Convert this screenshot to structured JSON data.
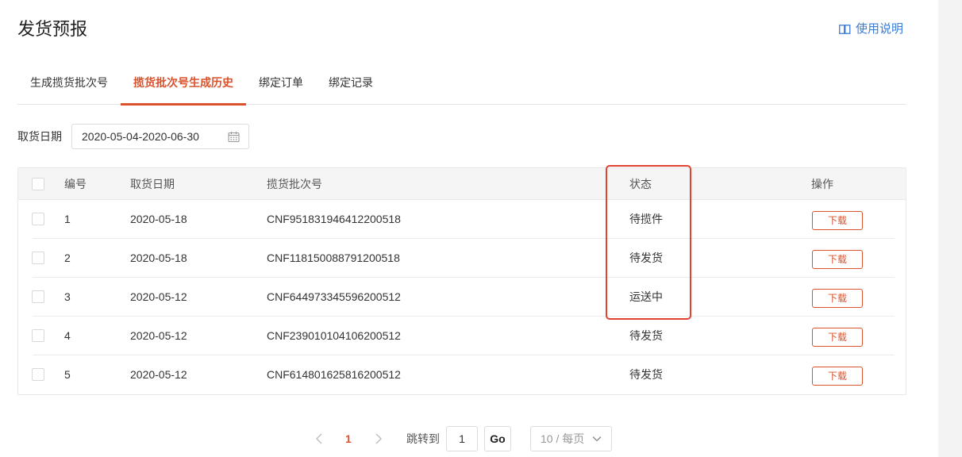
{
  "page": {
    "title": "发货预报"
  },
  "help": {
    "label": "使用说明"
  },
  "tabs": [
    {
      "label": "生成揽货批次号"
    },
    {
      "label": "揽货批次号生成历史"
    },
    {
      "label": "绑定订单"
    },
    {
      "label": "绑定记录"
    }
  ],
  "active_tab": 1,
  "filter": {
    "label": "取货日期",
    "value": "2020-05-04-2020-06-30"
  },
  "table": {
    "headers": {
      "id": "编号",
      "date": "取货日期",
      "batch": "揽货批次号",
      "status": "状态",
      "op": "操作"
    },
    "rows": [
      {
        "id": "1",
        "date": "2020-05-18",
        "batch": "CNF951831946412200518",
        "status": "待揽件",
        "action": "下载"
      },
      {
        "id": "2",
        "date": "2020-05-18",
        "batch": "CNF118150088791200518",
        "status": "待发货",
        "action": "下载"
      },
      {
        "id": "3",
        "date": "2020-05-12",
        "batch": "CNF644973345596200512",
        "status": "运送中",
        "action": "下载"
      },
      {
        "id": "4",
        "date": "2020-05-12",
        "batch": "CNF239010104106200512",
        "status": "待发货",
        "action": "下载"
      },
      {
        "id": "5",
        "date": "2020-05-12",
        "batch": "CNF614801625816200512",
        "status": "待发货",
        "action": "下载"
      }
    ]
  },
  "pagination": {
    "current_page": "1",
    "jump_label": "跳转到",
    "jump_value": "1",
    "go_label": "Go",
    "page_size": "10 / 每页"
  },
  "colors": {
    "accent": "#d9522c",
    "link": "#3a7bd5",
    "highlight": "#e0432f"
  }
}
